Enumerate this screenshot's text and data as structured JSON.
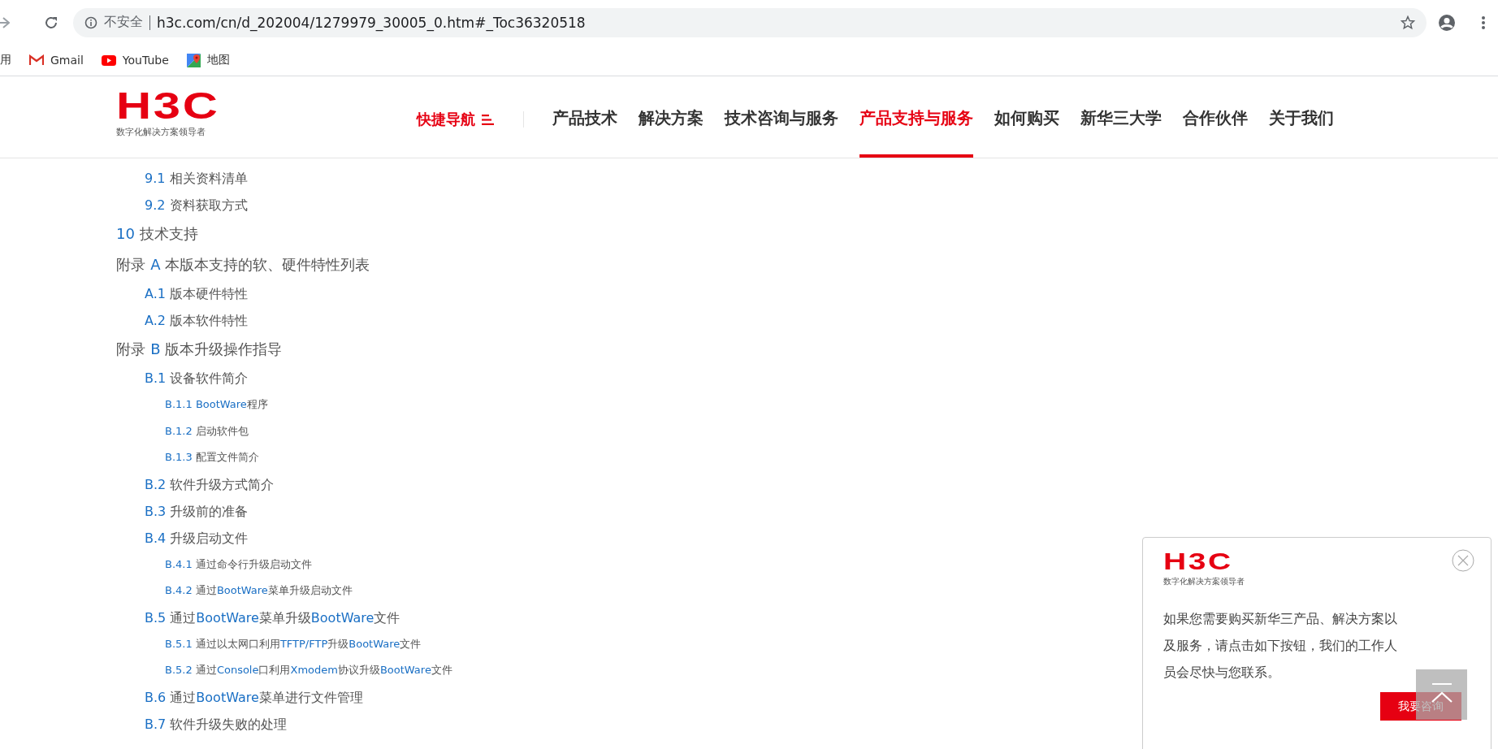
{
  "browser": {
    "security": "不安全",
    "url": "h3c.com/cn/d_202004/1279979_30005_0.htm#_Toc36320518",
    "bookmarks": [
      {
        "kind": "apps",
        "label": "用"
      },
      {
        "kind": "gmail",
        "label": "Gmail"
      },
      {
        "kind": "youtube",
        "label": "YouTube"
      },
      {
        "kind": "maps",
        "label": "地图"
      }
    ]
  },
  "header": {
    "logo": "H3C",
    "tagline": "数字化解决方案领导者",
    "quick_nav": "快捷导航",
    "nav": [
      {
        "label": "产品技术",
        "selected": false
      },
      {
        "label": "解决方案",
        "selected": false
      },
      {
        "label": "技术咨询与服务",
        "selected": false
      },
      {
        "label": "产品支持与服务",
        "selected": true
      },
      {
        "label": "如何购买",
        "selected": false
      },
      {
        "label": "新华三大学",
        "selected": false
      },
      {
        "label": "合作伙伴",
        "selected": false
      },
      {
        "label": "关于我们",
        "selected": false
      }
    ]
  },
  "toc": [
    {
      "children": [
        {
          "number": "9.1",
          "title": "相关资料清单"
        },
        {
          "number": "9.2",
          "title": "资料获取方式"
        }
      ]
    },
    {
      "number": "10",
      "title": "技术支持"
    },
    {
      "prefix": "附录",
      "number": "A",
      "title": "本版本支持的软、硬件特性列表",
      "children": [
        {
          "number": "A.1",
          "title": "版本硬件特性"
        },
        {
          "number": "A.2",
          "title": "版本软件特性"
        }
      ]
    },
    {
      "prefix": "附录",
      "number": "B",
      "title": "版本升级操作指导",
      "children": [
        {
          "number": "B.1",
          "title": "设备软件简介",
          "children": [
            {
              "number": "B.1.1",
              "title": "BootWare程序"
            },
            {
              "number": "B.1.2",
              "title": "启动软件包"
            },
            {
              "number": "B.1.3",
              "title": "配置文件简介"
            }
          ]
        },
        {
          "number": "B.2",
          "title": "软件升级方式简介"
        },
        {
          "number": "B.3",
          "title": "升级前的准备"
        },
        {
          "number": "B.4",
          "title": "升级启动文件",
          "children": [
            {
              "number": "B.4.1",
              "title": "通过命令行升级启动文件"
            },
            {
              "number": "B.4.2",
              "title": "通过BootWare菜单升级启动文件"
            }
          ]
        },
        {
          "number": "B.5",
          "title": "通过BootWare菜单升级BootWare文件",
          "children": [
            {
              "number": "B.5.1",
              "title": "通过以太网口利用TFTP/FTP升级BootWare文件"
            },
            {
              "number": "B.5.2",
              "title": "通过Console口利用Xmodem协议升级BootWare文件"
            }
          ]
        },
        {
          "number": "B.6",
          "title": "通过BootWare菜单进行文件管理"
        },
        {
          "number": "B.7",
          "title": "软件升级失败的处理"
        }
      ]
    }
  ],
  "popup": {
    "logo": "H3C",
    "tagline": "数字化解决方案领导者",
    "message": "如果您需要购买新华三产品、解决方案以及服务，请点击如下按钮，我们的工作人员会尽快与您联系。",
    "button": "我要咨询"
  }
}
